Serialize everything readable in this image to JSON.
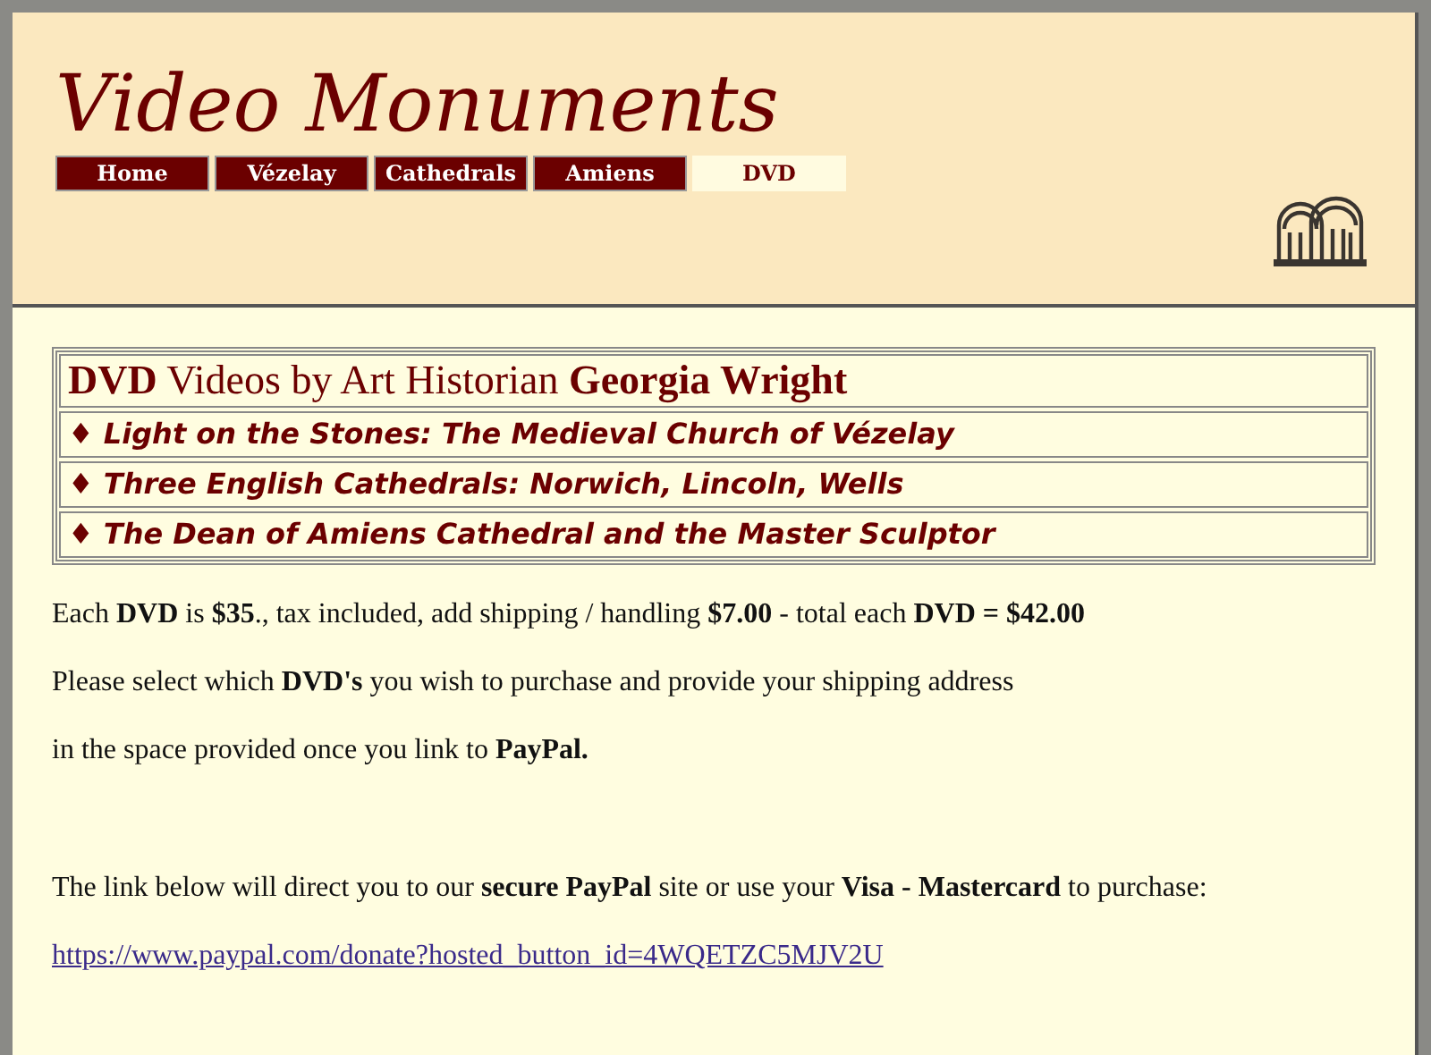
{
  "site_title": "Video Monuments",
  "tabs": [
    {
      "label": "Home",
      "selected": false
    },
    {
      "label": "Vézelay",
      "selected": false
    },
    {
      "label": "Cathedrals",
      "selected": false
    },
    {
      "label": "Amiens",
      "selected": false
    },
    {
      "label": "DVD",
      "selected": true
    }
  ],
  "dvd_table": {
    "heading": "**DVD** Videos by Art Historian **Georgia Wright**",
    "titles": [
      "♦ Light on the Stones: The Medieval Church of Vézelay",
      "♦ Three English Cathedrals: Norwich, Lincoln, Wells",
      "♦ The Dean of Amiens Cathedral and the Master Sculptor"
    ]
  },
  "paragraphs": [
    "Each **DVD** is **$35**., tax included, add shipping / handling **$7.00** - total each **DVD = $42.00**",
    "Please select which **DVD's** you wish to purchase and provide your shipping address",
    "in the space provided once you link to **PayPal.**",
    "The link below will direct you to our **secure PayPal** site or use your **Visa - Mastercard** to purchase:"
  ],
  "paypal_link": "https://www.paypal.com/donate?hosted_button_id=4WQETZC5MJV2U"
}
